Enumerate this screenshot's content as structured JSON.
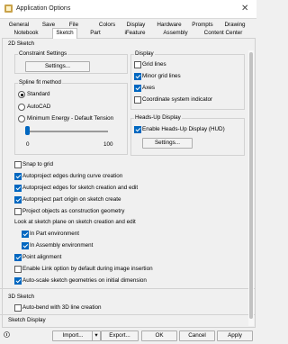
{
  "window": {
    "title": "Application Options",
    "close_glyph": "✕"
  },
  "tabs_row1": [
    "General",
    "Save",
    "File",
    "Colors",
    "Display",
    "Hardware",
    "Prompts",
    "Drawing"
  ],
  "tabs_row2": [
    "Notebook",
    "Sketch",
    "Part",
    "iFeature",
    "Assembly",
    "Content Center"
  ],
  "active_tab": "Sketch",
  "section_2d": "2D Sketch",
  "constraint": {
    "label": "Constraint Settings",
    "settings_button": "Settings..."
  },
  "spline": {
    "label": "Spline fit method",
    "options": [
      "Standard",
      "AutoCAD",
      "Minimum Energy - Default Tension"
    ],
    "selected": "Standard",
    "tension_value": 0,
    "slider_min": "0",
    "slider_max": "100"
  },
  "display": {
    "label": "Display",
    "items": [
      {
        "label": "Grid lines",
        "checked": false
      },
      {
        "label": "Minor grid lines",
        "checked": true
      },
      {
        "label": "Axes",
        "checked": true
      },
      {
        "label": "Coordinate system indicator",
        "checked": false
      }
    ]
  },
  "heads_up": {
    "label": "Heads-Up Display",
    "enable_label": "Enable Heads-Up Display (HUD)",
    "enable_checked": true,
    "settings_button": "Settings..."
  },
  "options": [
    {
      "label": "Snap to grid",
      "checked": false
    },
    {
      "label": "Autoproject edges during curve creation",
      "checked": true
    },
    {
      "label": "Autoproject edges for sketch creation and edit",
      "checked": true
    },
    {
      "label": "Autoproject part origin on sketch create",
      "checked": true
    },
    {
      "label": "Project objects as construction geometry",
      "checked": false
    }
  ],
  "look_at": {
    "label": "Look at sketch plane on sketch creation and edit",
    "items": [
      {
        "label": "In Part environment",
        "checked": true
      },
      {
        "label": "In Assembly environment",
        "checked": true
      }
    ]
  },
  "options2": [
    {
      "label": "Point alignment",
      "checked": true
    },
    {
      "label": "Enable Link option by default during image insertion",
      "checked": false
    },
    {
      "label": "Auto-scale sketch geometries on initial dimension",
      "checked": true
    }
  ],
  "section_3d": "3D Sketch",
  "auto_bend": {
    "label": "Auto-bend with 3D line creation",
    "checked": false
  },
  "section_display": "Sketch Display",
  "buttons": {
    "import": "Import...",
    "import_arrow": "▾",
    "export": "Export...",
    "ok": "OK",
    "cancel": "Cancel",
    "apply": "Apply"
  },
  "colors": {
    "accent": "#0067c0"
  }
}
